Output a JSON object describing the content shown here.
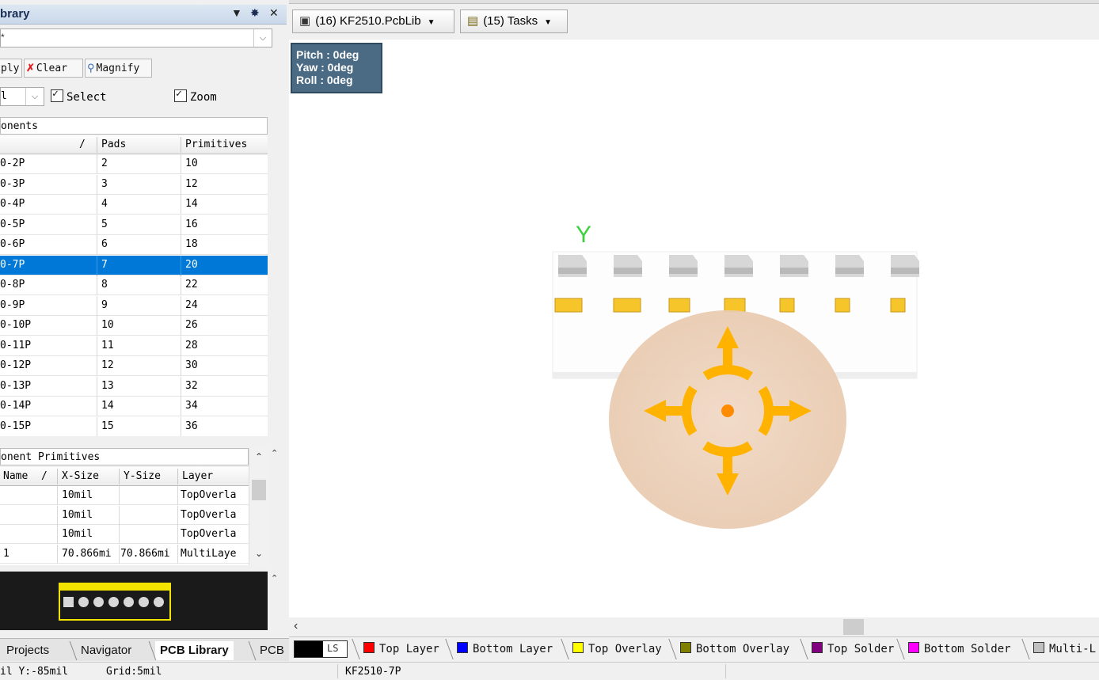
{
  "panel": {
    "title": "brary",
    "controls": {
      "menu": "▼",
      "pin": "✸",
      "close": "✕"
    },
    "filter_value": "*",
    "buttons": {
      "apply": "ply",
      "clear": "Clear",
      "magnify": "Magnify"
    },
    "mask_value": "l",
    "checks": {
      "select": "Select",
      "zoom": "Zoom"
    }
  },
  "components": {
    "section_title": "onents",
    "columns": {
      "name_sort": "/",
      "pads": "Pads",
      "primitives": "Primitives"
    },
    "rows": [
      {
        "name": "0-2P",
        "pads": "2",
        "prims": "10"
      },
      {
        "name": "0-3P",
        "pads": "3",
        "prims": "12"
      },
      {
        "name": "0-4P",
        "pads": "4",
        "prims": "14"
      },
      {
        "name": "0-5P",
        "pads": "5",
        "prims": "16"
      },
      {
        "name": "0-6P",
        "pads": "6",
        "prims": "18"
      },
      {
        "name": "0-7P",
        "pads": "7",
        "prims": "20"
      },
      {
        "name": "0-8P",
        "pads": "8",
        "prims": "22"
      },
      {
        "name": "0-9P",
        "pads": "9",
        "prims": "24"
      },
      {
        "name": "0-10P",
        "pads": "10",
        "prims": "26"
      },
      {
        "name": "0-11P",
        "pads": "11",
        "prims": "28"
      },
      {
        "name": "0-12P",
        "pads": "12",
        "prims": "30"
      },
      {
        "name": "0-13P",
        "pads": "13",
        "prims": "32"
      },
      {
        "name": "0-14P",
        "pads": "14",
        "prims": "34"
      },
      {
        "name": "0-15P",
        "pads": "15",
        "prims": "36"
      }
    ],
    "selected_index": 5
  },
  "primitives": {
    "section_title": "onent Primitives",
    "columns": {
      "name": "Name",
      "sort": "/",
      "xsize": "X-Size",
      "ysize": "Y-Size",
      "layer": "Layer"
    },
    "rows": [
      {
        "name": "",
        "xsize": "10mil",
        "ysize": "",
        "layer": "TopOverla"
      },
      {
        "name": "",
        "xsize": "10mil",
        "ysize": "",
        "layer": "TopOverla"
      },
      {
        "name": "",
        "xsize": "10mil",
        "ysize": "",
        "layer": "TopOverla"
      },
      {
        "name": "1",
        "xsize": "70.866mi",
        "ysize": "70.866mi",
        "layer": "MultiLaye"
      }
    ]
  },
  "left_tabs": [
    "Projects",
    "Navigator",
    "PCB Library",
    "PCB"
  ],
  "left_tab_active": "PCB Library",
  "doc_bar": {
    "lib_button": "(16) KF2510.PcbLib",
    "tasks_button": "(15) Tasks"
  },
  "orientation": {
    "pitch": "Pitch : 0deg",
    "yaw": "Yaw : 0deg",
    "roll": "Roll : 0deg"
  },
  "canvas": {
    "axis_label": "Y",
    "pad_count": 7
  },
  "layers": {
    "ls_label": "LS",
    "tabs": [
      {
        "name": "Top Layer",
        "color": "#ff0000"
      },
      {
        "name": "Bottom Layer",
        "color": "#0000ff"
      },
      {
        "name": "Top Overlay",
        "color": "#ffff00"
      },
      {
        "name": "Bottom Overlay",
        "color": "#808000"
      },
      {
        "name": "Top Solder",
        "color": "#800080"
      },
      {
        "name": "Bottom Solder",
        "color": "#ff00ff"
      },
      {
        "name": "Multi-L",
        "color": "#c0c0c0"
      }
    ]
  },
  "status": {
    "coords": "il Y:-85mil",
    "grid": "Grid:5mil",
    "component": "KF2510-7P"
  }
}
